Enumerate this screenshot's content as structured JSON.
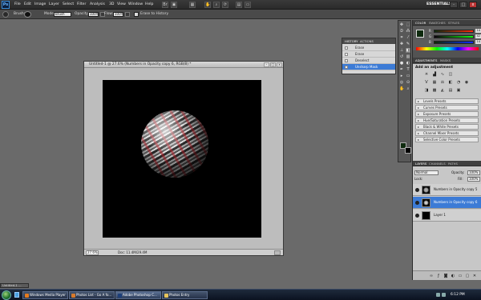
{
  "app": {
    "logo": "Ps",
    "menu": [
      "File",
      "Edit",
      "Image",
      "Layer",
      "Select",
      "Filter",
      "Analysis",
      "3D",
      "View",
      "Window",
      "Help"
    ],
    "workspace": "ESSENTIALS ▾",
    "window_controls": [
      "-",
      "□",
      "x"
    ]
  },
  "options_bar": {
    "brush_label": "Brush:",
    "mode_label": "Mode:",
    "mode_value": "Brush",
    "opacity_label": "Opacity:",
    "opacity_value": "100%",
    "flow_label": "Flow:",
    "flow_value": "100%",
    "erase_history_label": "Erase to History"
  },
  "document": {
    "title": "Untitled-1 @ 27.6% (Numbers in Opacity copy 6, RGB/8) *",
    "zoom": "27.6%",
    "doc_size": "Doc: 11.4M/29.4M"
  },
  "history_panel": {
    "tabs": [
      "HISTORY",
      "ACTIONS"
    ],
    "rows": [
      {
        "label": "Erase",
        "selected": false
      },
      {
        "label": "Erase",
        "selected": false
      },
      {
        "label": "Deselect",
        "selected": false
      },
      {
        "label": "Unsharp Mask",
        "selected": true
      }
    ]
  },
  "color_panel": {
    "tabs": [
      "COLOR",
      "SWATCHES",
      "STYLES"
    ],
    "sliders": [
      {
        "label": "R",
        "value": "14",
        "color": "#e03030"
      },
      {
        "label": "G",
        "value": "42",
        "color": "#30c030"
      },
      {
        "label": "B",
        "value": "14",
        "color": "#3050e0"
      }
    ]
  },
  "adjustments_panel": {
    "tabs": [
      "ADJUSTMENTS",
      "MASKS"
    ],
    "title": "Add an adjustment",
    "presets": [
      "Levels Presets",
      "Curves Presets",
      "Exposure Presets",
      "Hue/Saturation Presets",
      "Black & White Presets",
      "Channel Mixer Presets",
      "Selective Color Presets"
    ]
  },
  "layers_panel": {
    "tabs": [
      "LAYERS",
      "CHANNELS",
      "PATHS"
    ],
    "blend_mode": "Normal",
    "opacity_label": "Opacity:",
    "opacity_value": "100%",
    "lock_label": "Lock:",
    "fill_label": "Fill:",
    "fill_value": "100%",
    "layers": [
      {
        "name": "Numbers in Opacity copy 5",
        "selected": false
      },
      {
        "name": "Numbers in Opacity copy 6",
        "selected": true
      },
      {
        "name": "Layer 1",
        "selected": false
      }
    ]
  },
  "minimized_doc": {
    "label": "Untitled-1 ..."
  },
  "taskbar": {
    "tasks": [
      {
        "label": "Windows Media Player",
        "icon_color": "#e37b1f"
      },
      {
        "label": "Photos List - Go A fo...",
        "icon_color": "#d87a2b"
      },
      {
        "label": "Adobe Photoshop C...",
        "icon_color": "#1d3f7a"
      },
      {
        "label": "Photos Entry",
        "icon_color": "#e7c45a"
      }
    ],
    "clock": "6:12 PM"
  }
}
